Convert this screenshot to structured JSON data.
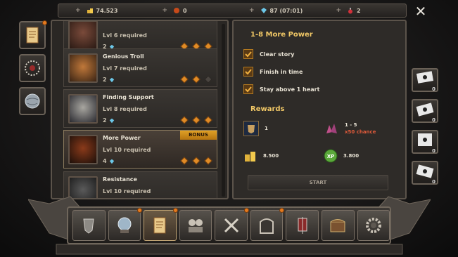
{
  "resources": {
    "gold": "74.523",
    "bombs": "0",
    "gems": "87 (07:01)",
    "potions": "2"
  },
  "missions": [
    {
      "name": "",
      "level": "Lvl 6 required",
      "gems": "2",
      "stars": 3,
      "bonus": ""
    },
    {
      "name": "Genious Troll",
      "level": "Lvl 7 required",
      "gems": "2",
      "stars": 2,
      "bonus": ""
    },
    {
      "name": "Finding Support",
      "level": "Lvl 8 required",
      "gems": "2",
      "stars": 3,
      "bonus": ""
    },
    {
      "name": "More Power",
      "level": "Lvl 10 required",
      "gems": "4",
      "stars": 3,
      "bonus": "BONUS"
    },
    {
      "name": "Resistance",
      "level": "Lvl 10 required",
      "gems": "",
      "stars": 0,
      "bonus": ""
    }
  ],
  "detail": {
    "title": "1-8 More Power",
    "objectives": [
      "Clear story",
      "Finish in time",
      "Stay above 1 heart"
    ],
    "rewards_label": "Rewards",
    "rewards": {
      "item_count": "1",
      "shard_range": "1 - 5",
      "shard_chance": "x50 chance",
      "gold": "8.500",
      "xp": "3.800"
    },
    "start_label": "START"
  },
  "cards": [
    "0",
    "0",
    "0",
    "0"
  ],
  "colors": {
    "accent": "#f0c766",
    "bonus": "#e0a126",
    "notify": "#e57a1e"
  }
}
